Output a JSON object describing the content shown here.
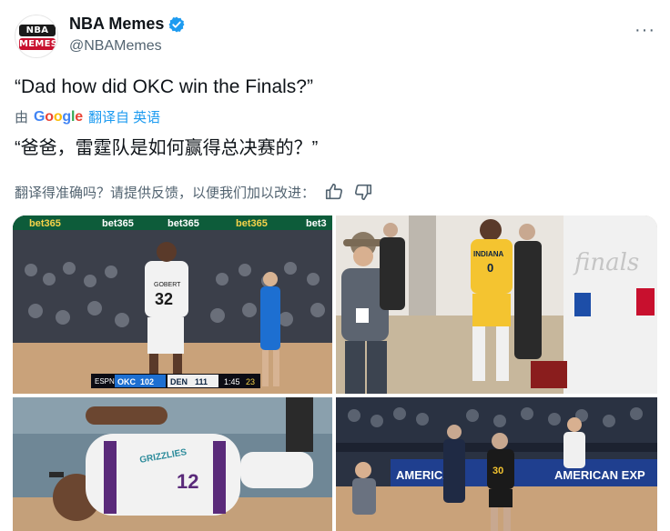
{
  "author": {
    "display_name": "NBA Memes",
    "handle": "@NBAMemes",
    "avatar_lines": [
      "NBA",
      "MEMES"
    ],
    "verified_icon": "verified-badge-icon",
    "verified_color": "#1d9bf0"
  },
  "more_label": "···",
  "tweet": {
    "text": "“Dad how did OKC win the Finals?”"
  },
  "translation": {
    "by_label": "由",
    "provider": [
      "G",
      "o",
      "o",
      "g",
      "l",
      "e"
    ],
    "link_label": "翻译自 英语",
    "text": "“爸爸，雷霆队是如何赢得总决赛的？”",
    "feedback_prompt": "翻译得准确吗？请提供反馈，以便我们加以改进：",
    "thumbs_up_icon": "thumbs-up-icon",
    "thumbs_down_icon": "thumbs-down-icon"
  },
  "media": {
    "photo1": {
      "ad_text": [
        "bet365",
        "bet365",
        "bet365",
        "bet365",
        "bet3"
      ],
      "jersey_name": "GOBERT",
      "jersey_number": "32",
      "score_home": "OKC",
      "score_home_pts": "102",
      "score_away": "DEN",
      "score_away_pts": "111",
      "clock": "1:45",
      "shot_clock": "23",
      "network": "ESPN"
    },
    "photo2": {
      "jersey_team": "INDIANA",
      "jersey_number": "0",
      "banner_text": "finals"
    },
    "photo3": {
      "jersey_text": "GRIZZLIES",
      "jersey_number": "12"
    },
    "photo4": {
      "banner_left": "AMERICAN",
      "banner_right": "AMERICAN EXP",
      "jersey_number": "30"
    }
  },
  "colors": {
    "text_primary": "#0f1419",
    "text_secondary": "#536471",
    "link": "#1d9bf0"
  }
}
